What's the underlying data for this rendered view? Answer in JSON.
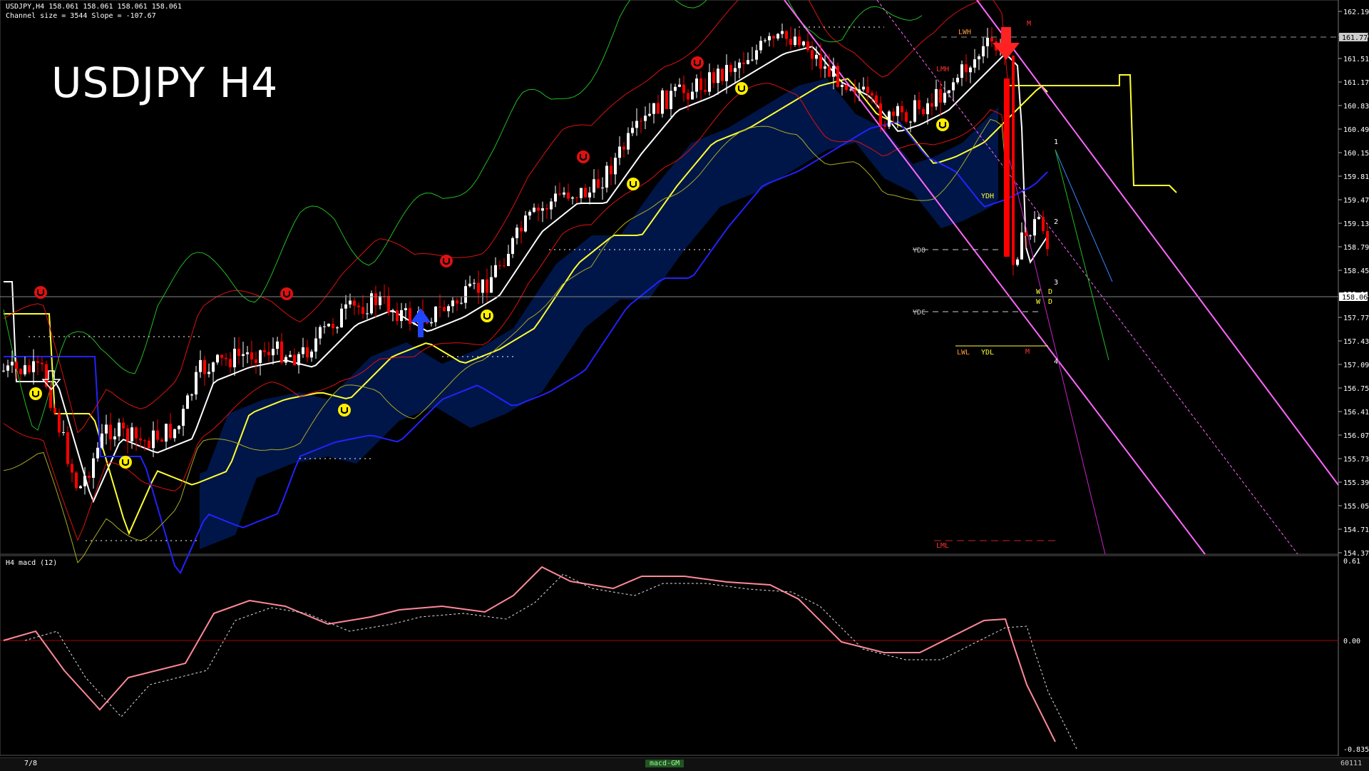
{
  "header": {
    "symbol_line": "USDJPY,H4  158.061 158.061 158.061 158.061",
    "channel_line": "Channel size = 3544 Slope = -107.67"
  },
  "title": "USDJPY H4",
  "main_axis": {
    "labels": [
      "162.190",
      "161.850",
      "161.510",
      "161.170",
      "160.830",
      "160.490",
      "160.150",
      "159.810",
      "159.470",
      "159.130",
      "158.790",
      "158.450",
      "158.110",
      "157.770",
      "157.430",
      "157.090",
      "156.750",
      "156.410",
      "156.070",
      "155.730",
      "155.390",
      "155.050",
      "154.710",
      "154.370"
    ],
    "hl_level": "161.778",
    "current_price": "158.061"
  },
  "level_labels": {
    "lwh": "LWH",
    "lmh": "LMH",
    "ydh": "YDH",
    "ydo": "YDO",
    "ydc": "YDC",
    "lwl": "LWL",
    "ydl": "YDL",
    "lml": "LML",
    "m_top": "M",
    "m_bottom": "M",
    "wave1": "1",
    "wave2": "2",
    "wave3": "3",
    "wave4": "4",
    "w1": "W",
    "d1": "D",
    "w2": "W",
    "d2": "D"
  },
  "sub_window": {
    "label": "H4  macd (12)",
    "top_value": "0.61",
    "zero_value": "0.00",
    "bottom_value": "-0.835"
  },
  "status_bar": {
    "page": "7/8",
    "tab": "macd-GM",
    "right": "60111"
  },
  "colors": {
    "up": "#ffffff",
    "down": "#ff0000",
    "ma_yellow": "#ffff33",
    "ma_blue": "#2222ff",
    "ma_white": "#ffffff",
    "green": "#22bb22",
    "magenta": "#ff66ff",
    "macd_up": "#33dd33",
    "macd_down": "#ff8899"
  }
}
